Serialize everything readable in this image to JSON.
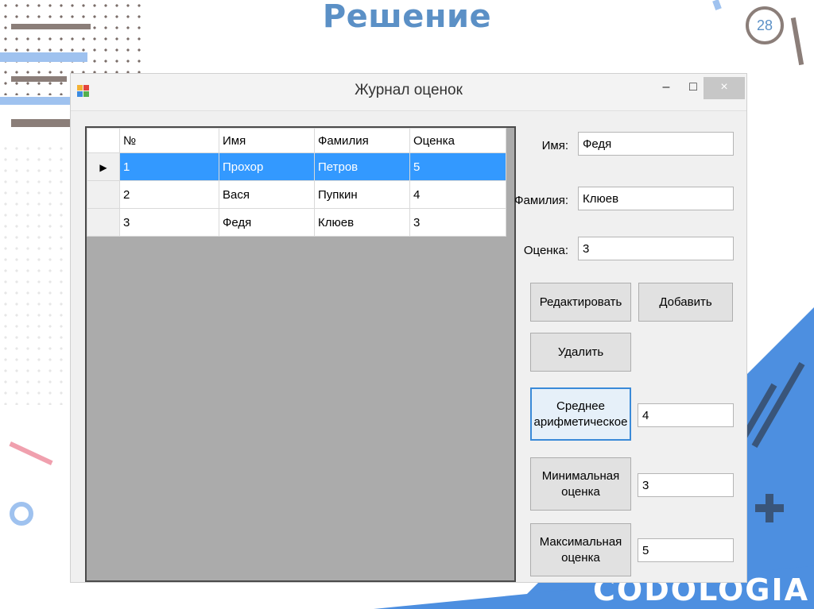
{
  "slide": {
    "title": "Решение",
    "page_number": "28",
    "logo": "CODOLOGIA"
  },
  "window": {
    "title": "Журнал оценок",
    "minimize": "–",
    "maximize": "□",
    "close": "×"
  },
  "grid": {
    "columns": [
      "№",
      "Имя",
      "Фамилия",
      "Оценка"
    ],
    "rows": [
      {
        "num": "1",
        "name": "Прохор",
        "surname": "Петров",
        "grade": "5",
        "selected": true
      },
      {
        "num": "2",
        "name": "Вася",
        "surname": "Пупкин",
        "grade": "4",
        "selected": false
      },
      {
        "num": "3",
        "name": "Федя",
        "surname": "Клюев",
        "grade": "3",
        "selected": false
      }
    ],
    "row_indicator": "▶"
  },
  "form": {
    "name_label": "Имя:",
    "name_value": "Федя",
    "surname_label": "Фамилия:",
    "surname_value": "Клюев",
    "grade_label": "Оценка:",
    "grade_value": "3"
  },
  "buttons": {
    "edit": "Редактировать",
    "add": "Добавить",
    "delete": "Удалить",
    "average_line1": "Среднее",
    "average_line2": "арифметическое",
    "min_line1": "Минимальная",
    "min_line2": "оценка",
    "max_line1": "Максимальная",
    "max_line2": "оценка"
  },
  "results": {
    "average": "4",
    "min": "3",
    "max": "5"
  },
  "colors": {
    "title": "#5b90c6",
    "selection": "#3399ff",
    "accent": "#4d8fe0"
  }
}
